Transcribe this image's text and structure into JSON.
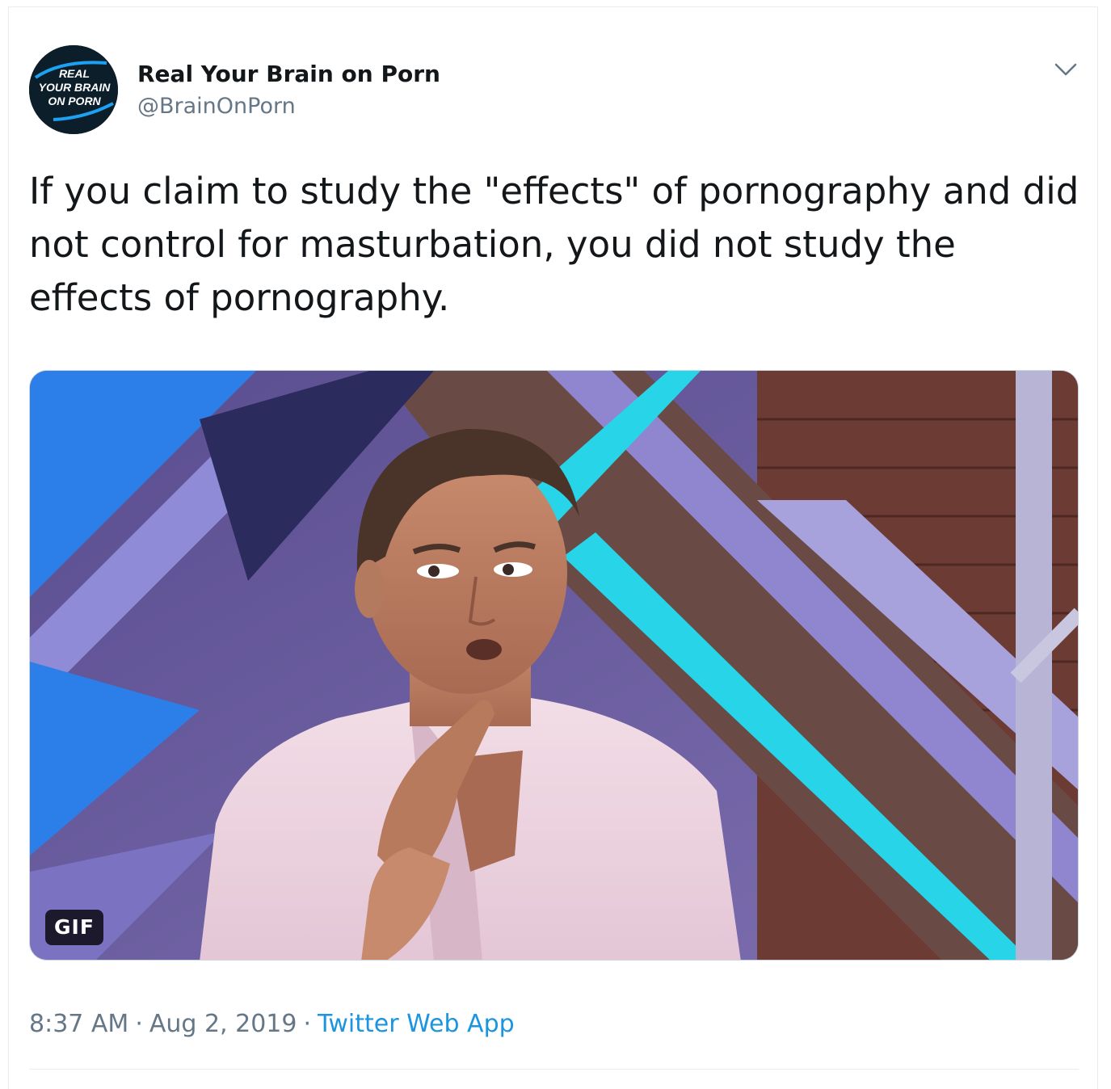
{
  "tweet": {
    "author": {
      "display_name": "Real Your Brain on Porn",
      "handle": "@BrainOnPorn",
      "avatar": {
        "logo_lines": [
          "REAL",
          "YOUR BRAIN",
          "ON PORN"
        ],
        "background_color": "#0b1e29",
        "accent_color": "#1da1f2"
      }
    },
    "caret_icon": "chevron-down-icon",
    "text": "If you claim to study the \"effects\" of pornography and did not control for masturbation, you did not study the effects of pornography.",
    "media": {
      "type": "gif",
      "badge": "GIF"
    },
    "time": "8:37 AM",
    "date": "Aug 2, 2019",
    "separator": "·",
    "source": "Twitter Web App"
  },
  "colors": {
    "text_primary": "#14171a",
    "text_secondary": "#657786",
    "link": "#1b95e0",
    "border": "#e6ecf0"
  }
}
